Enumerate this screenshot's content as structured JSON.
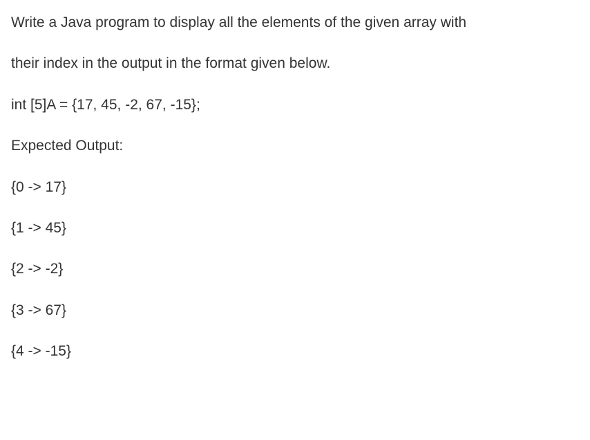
{
  "question": {
    "line1": "Write a Java program to display all the elements of the given array with",
    "line2": "their index in the output in the format given below."
  },
  "declaration": "int [5]A = {17, 45, -2, 67, -15};",
  "expected_label": "Expected Output:",
  "outputs": [
    "{0 -> 17}",
    "{1 -> 45}",
    "{2 -> -2}",
    "{3 -> 67}",
    "{4 -> -15}"
  ]
}
